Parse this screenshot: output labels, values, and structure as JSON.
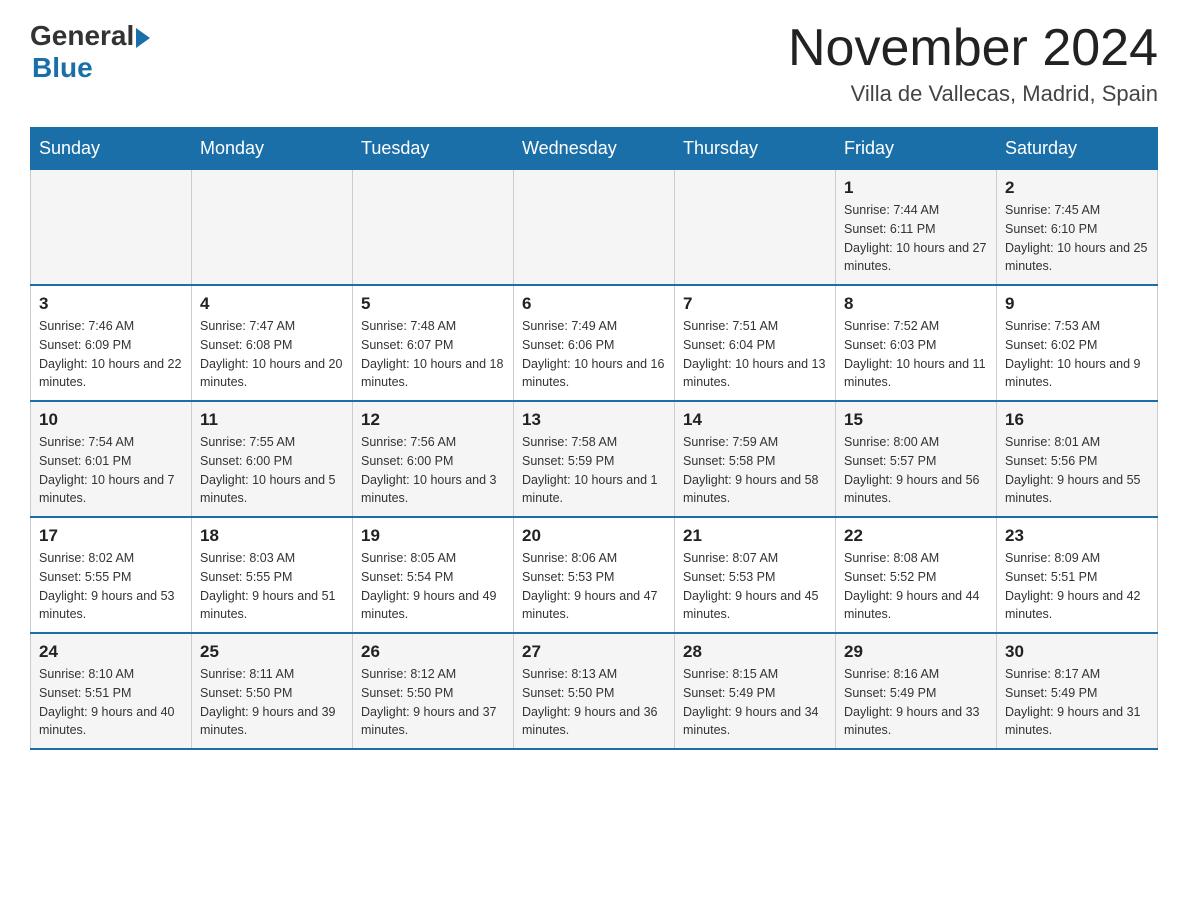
{
  "header": {
    "logo_general": "General",
    "logo_blue": "Blue",
    "month_title": "November 2024",
    "location": "Villa de Vallecas, Madrid, Spain"
  },
  "weekdays": [
    "Sunday",
    "Monday",
    "Tuesday",
    "Wednesday",
    "Thursday",
    "Friday",
    "Saturday"
  ],
  "weeks": [
    [
      {
        "day": "",
        "info": ""
      },
      {
        "day": "",
        "info": ""
      },
      {
        "day": "",
        "info": ""
      },
      {
        "day": "",
        "info": ""
      },
      {
        "day": "",
        "info": ""
      },
      {
        "day": "1",
        "info": "Sunrise: 7:44 AM\nSunset: 6:11 PM\nDaylight: 10 hours and 27 minutes."
      },
      {
        "day": "2",
        "info": "Sunrise: 7:45 AM\nSunset: 6:10 PM\nDaylight: 10 hours and 25 minutes."
      }
    ],
    [
      {
        "day": "3",
        "info": "Sunrise: 7:46 AM\nSunset: 6:09 PM\nDaylight: 10 hours and 22 minutes."
      },
      {
        "day": "4",
        "info": "Sunrise: 7:47 AM\nSunset: 6:08 PM\nDaylight: 10 hours and 20 minutes."
      },
      {
        "day": "5",
        "info": "Sunrise: 7:48 AM\nSunset: 6:07 PM\nDaylight: 10 hours and 18 minutes."
      },
      {
        "day": "6",
        "info": "Sunrise: 7:49 AM\nSunset: 6:06 PM\nDaylight: 10 hours and 16 minutes."
      },
      {
        "day": "7",
        "info": "Sunrise: 7:51 AM\nSunset: 6:04 PM\nDaylight: 10 hours and 13 minutes."
      },
      {
        "day": "8",
        "info": "Sunrise: 7:52 AM\nSunset: 6:03 PM\nDaylight: 10 hours and 11 minutes."
      },
      {
        "day": "9",
        "info": "Sunrise: 7:53 AM\nSunset: 6:02 PM\nDaylight: 10 hours and 9 minutes."
      }
    ],
    [
      {
        "day": "10",
        "info": "Sunrise: 7:54 AM\nSunset: 6:01 PM\nDaylight: 10 hours and 7 minutes."
      },
      {
        "day": "11",
        "info": "Sunrise: 7:55 AM\nSunset: 6:00 PM\nDaylight: 10 hours and 5 minutes."
      },
      {
        "day": "12",
        "info": "Sunrise: 7:56 AM\nSunset: 6:00 PM\nDaylight: 10 hours and 3 minutes."
      },
      {
        "day": "13",
        "info": "Sunrise: 7:58 AM\nSunset: 5:59 PM\nDaylight: 10 hours and 1 minute."
      },
      {
        "day": "14",
        "info": "Sunrise: 7:59 AM\nSunset: 5:58 PM\nDaylight: 9 hours and 58 minutes."
      },
      {
        "day": "15",
        "info": "Sunrise: 8:00 AM\nSunset: 5:57 PM\nDaylight: 9 hours and 56 minutes."
      },
      {
        "day": "16",
        "info": "Sunrise: 8:01 AM\nSunset: 5:56 PM\nDaylight: 9 hours and 55 minutes."
      }
    ],
    [
      {
        "day": "17",
        "info": "Sunrise: 8:02 AM\nSunset: 5:55 PM\nDaylight: 9 hours and 53 minutes."
      },
      {
        "day": "18",
        "info": "Sunrise: 8:03 AM\nSunset: 5:55 PM\nDaylight: 9 hours and 51 minutes."
      },
      {
        "day": "19",
        "info": "Sunrise: 8:05 AM\nSunset: 5:54 PM\nDaylight: 9 hours and 49 minutes."
      },
      {
        "day": "20",
        "info": "Sunrise: 8:06 AM\nSunset: 5:53 PM\nDaylight: 9 hours and 47 minutes."
      },
      {
        "day": "21",
        "info": "Sunrise: 8:07 AM\nSunset: 5:53 PM\nDaylight: 9 hours and 45 minutes."
      },
      {
        "day": "22",
        "info": "Sunrise: 8:08 AM\nSunset: 5:52 PM\nDaylight: 9 hours and 44 minutes."
      },
      {
        "day": "23",
        "info": "Sunrise: 8:09 AM\nSunset: 5:51 PM\nDaylight: 9 hours and 42 minutes."
      }
    ],
    [
      {
        "day": "24",
        "info": "Sunrise: 8:10 AM\nSunset: 5:51 PM\nDaylight: 9 hours and 40 minutes."
      },
      {
        "day": "25",
        "info": "Sunrise: 8:11 AM\nSunset: 5:50 PM\nDaylight: 9 hours and 39 minutes."
      },
      {
        "day": "26",
        "info": "Sunrise: 8:12 AM\nSunset: 5:50 PM\nDaylight: 9 hours and 37 minutes."
      },
      {
        "day": "27",
        "info": "Sunrise: 8:13 AM\nSunset: 5:50 PM\nDaylight: 9 hours and 36 minutes."
      },
      {
        "day": "28",
        "info": "Sunrise: 8:15 AM\nSunset: 5:49 PM\nDaylight: 9 hours and 34 minutes."
      },
      {
        "day": "29",
        "info": "Sunrise: 8:16 AM\nSunset: 5:49 PM\nDaylight: 9 hours and 33 minutes."
      },
      {
        "day": "30",
        "info": "Sunrise: 8:17 AM\nSunset: 5:49 PM\nDaylight: 9 hours and 31 minutes."
      }
    ]
  ]
}
